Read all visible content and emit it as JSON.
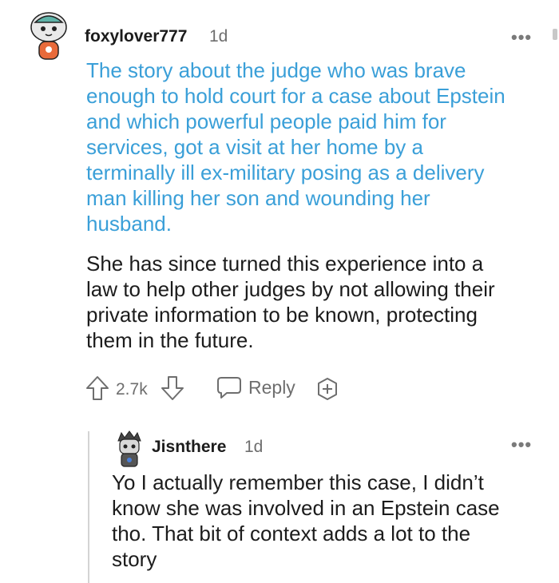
{
  "comments": [
    {
      "username": "foxylover777",
      "age": "1d",
      "highlighted_lines": [
        "The story about the judge who was brave",
        "enough to hold court for a case about Epstein",
        "and which powerful people paid him for",
        "services, got a visit at her home by a",
        "terminally ill ex-military posing as a delivery",
        "man killing her son and wounding her",
        "husband."
      ],
      "body_lines": [
        "She has since turned this experience into a",
        "law to help other judges by not allowing their",
        "private information to be known, protecting",
        "them in the future."
      ],
      "vote_count": "2.7k",
      "reply_label": "Reply"
    },
    {
      "username": "Jisnthere",
      "age": "1d",
      "body_lines": [
        "Yo I actually remember this case, I didn’t",
        "know she was involved in an Epstein case",
        "tho. That bit of context adds a lot to the",
        "story"
      ]
    }
  ],
  "more_glyph": "•••",
  "icons": {
    "upvote": "arrow-up-icon",
    "downvote": "arrow-down-icon",
    "reply": "speech-bubble-icon",
    "award": "plus-circle-icon"
  },
  "colors": {
    "highlight_text": "#3a9fd8",
    "muted": "#6e6e6e"
  }
}
